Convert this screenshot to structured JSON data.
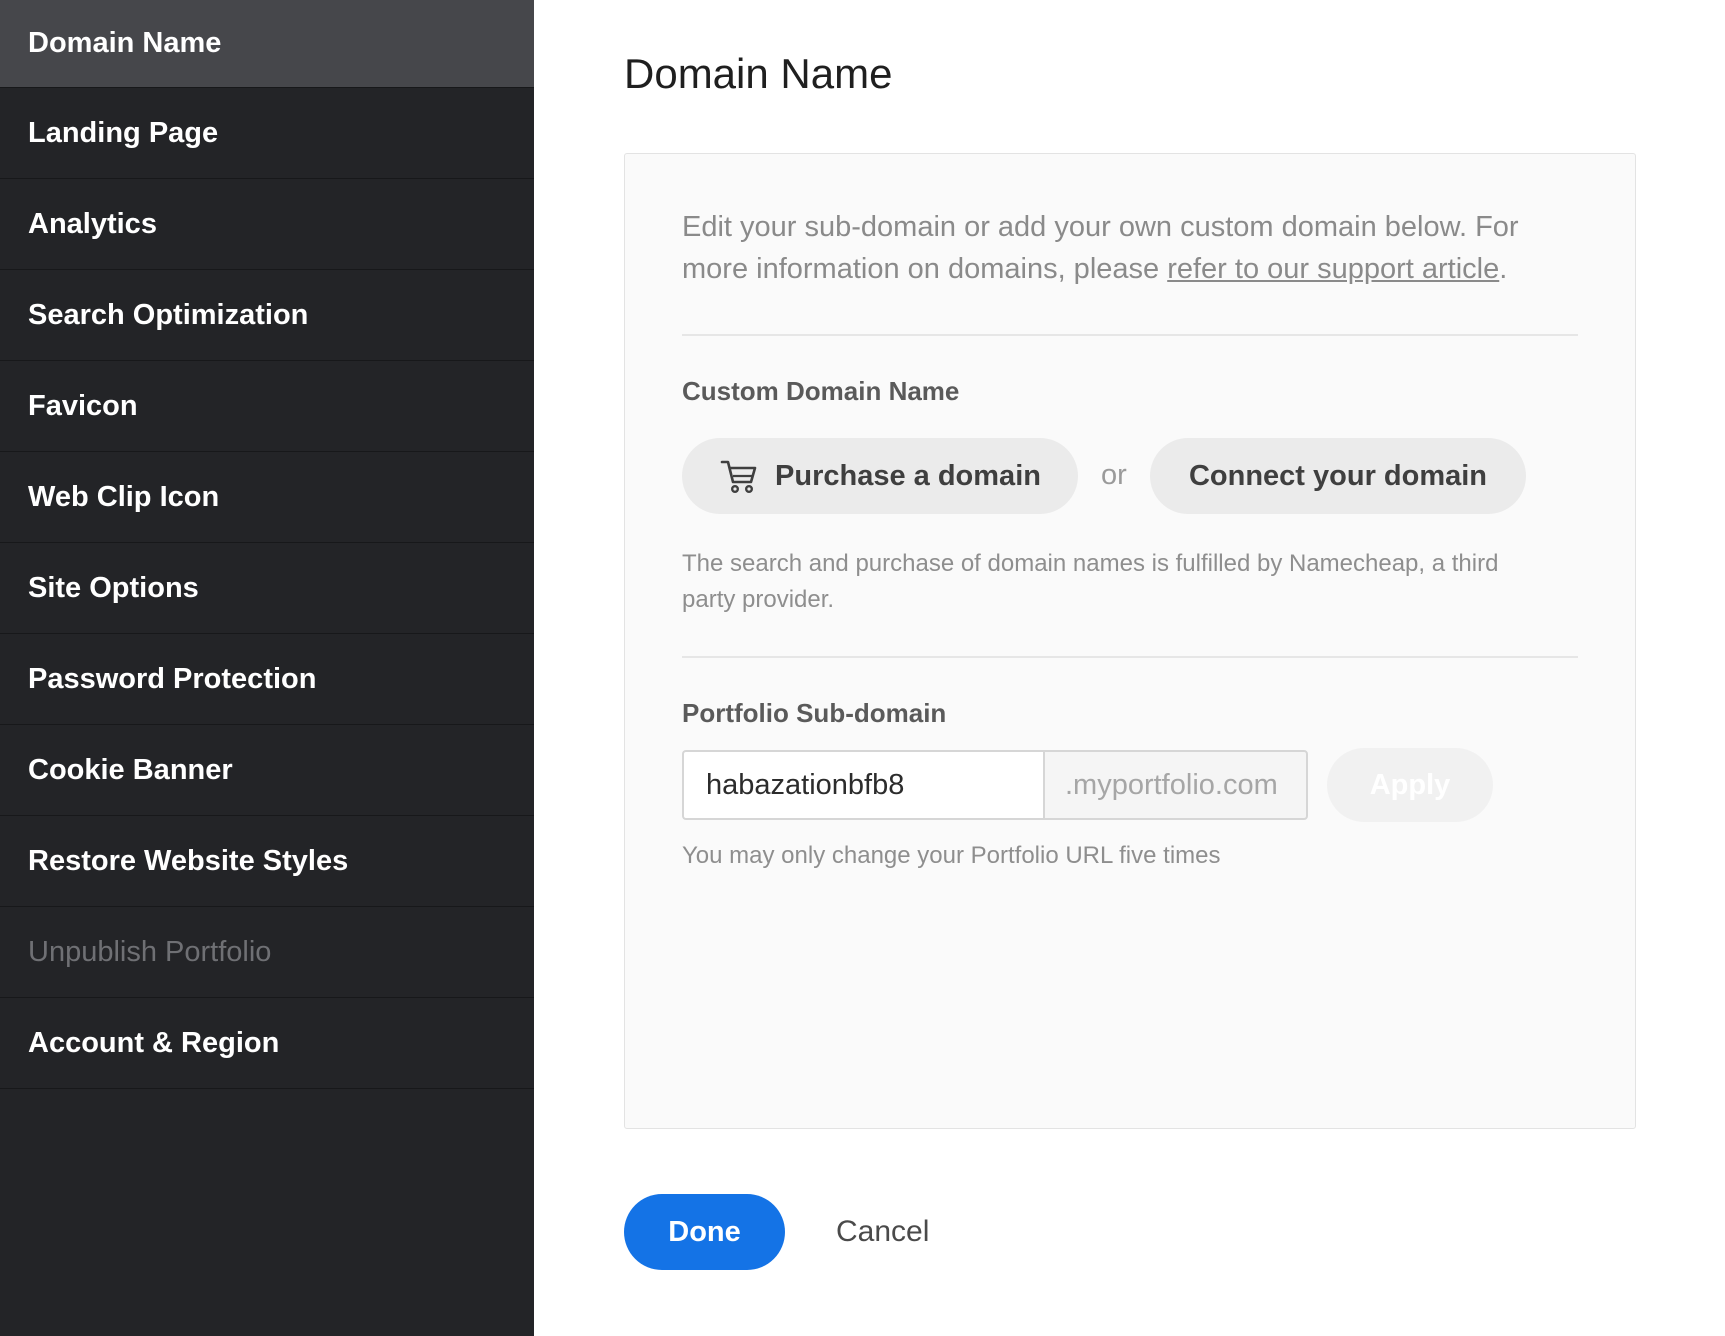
{
  "sidebar": {
    "items": [
      {
        "label": "Domain Name"
      },
      {
        "label": "Landing Page"
      },
      {
        "label": "Analytics"
      },
      {
        "label": "Search Optimization"
      },
      {
        "label": "Favicon"
      },
      {
        "label": "Web Clip Icon"
      },
      {
        "label": "Site Options"
      },
      {
        "label": "Password Protection"
      },
      {
        "label": "Cookie Banner"
      },
      {
        "label": "Restore Website Styles"
      },
      {
        "label": "Unpublish Portfolio"
      },
      {
        "label": "Account & Region"
      }
    ]
  },
  "main": {
    "title": "Domain Name",
    "intro_text": "Edit your sub-domain or add your own custom domain below. For more information on domains, please ",
    "intro_link": "refer to our support article",
    "intro_end": ".",
    "custom_domain": {
      "label": "Custom Domain Name",
      "purchase_label": "Purchase a domain",
      "purchase_icon": "cart-icon",
      "or_text": "or",
      "connect_label": "Connect your domain",
      "note": "The search and purchase of domain names is fulfilled by Namecheap, a third party provider."
    },
    "subdomain": {
      "label": "Portfolio Sub-domain",
      "value": "habazationbfb8",
      "suffix": ".myportfolio.com",
      "apply_label": "Apply",
      "note": "You may only change your Portfolio URL five times"
    },
    "done_label": "Done",
    "cancel_label": "Cancel"
  },
  "colors": {
    "sidebar_bg": "#232427",
    "sidebar_active_bg": "#46474b",
    "accent": "#1473e6"
  }
}
